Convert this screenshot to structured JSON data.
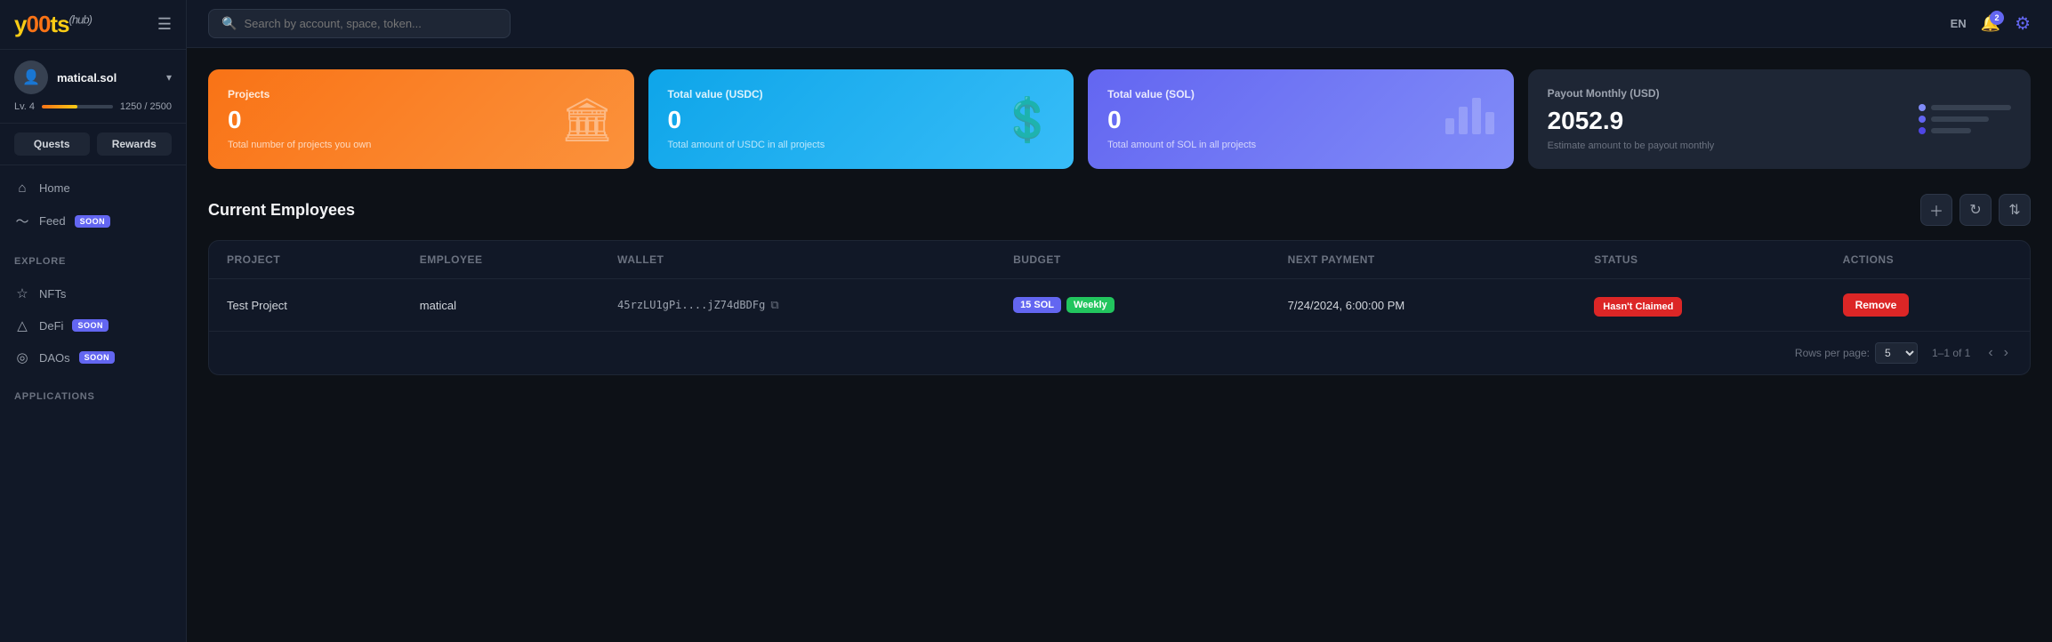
{
  "app": {
    "logo": "y00ts",
    "hub_label": "(hub)"
  },
  "header": {
    "search_placeholder": "Search by account, space, token...",
    "lang_label": "EN",
    "notif_count": "2"
  },
  "sidebar": {
    "user": {
      "username": "matical.sol",
      "level": "Lv. 4",
      "progress_text": "1250 / 2500",
      "progress_pct": 50
    },
    "quests_label": "Quests",
    "rewards_label": "Rewards",
    "nav_items": [
      {
        "id": "home",
        "label": "Home",
        "icon": "⌂",
        "soon": false
      },
      {
        "id": "feed",
        "label": "Feed",
        "icon": "〜",
        "soon": true
      }
    ],
    "explore_label": "Explore",
    "explore_items": [
      {
        "id": "nfts",
        "label": "NFTs",
        "icon": "☆",
        "soon": false
      },
      {
        "id": "defi",
        "label": "DeFi",
        "icon": "△",
        "soon": true
      },
      {
        "id": "daos",
        "label": "DAOs",
        "icon": "◎",
        "soon": true
      }
    ],
    "applications_label": "Applications"
  },
  "stats": {
    "projects": {
      "label": "Projects",
      "value": "0",
      "description": "Total number of projects you own"
    },
    "usdc": {
      "label": "Total value (USDC)",
      "value": "0",
      "description": "Total amount of USDC in all projects"
    },
    "sol": {
      "label": "Total value (SOL)",
      "value": "0",
      "description": "Total amount of SOL in all projects"
    },
    "payout": {
      "label": "Payout Monthly (USD)",
      "value": "2052.9",
      "description": "Estimate amount to be payout monthly"
    }
  },
  "employees": {
    "section_title": "Current Employees",
    "columns": {
      "project": "Project",
      "employee": "Employee",
      "wallet": "Wallet",
      "budget": "Budget",
      "next_payment": "Next Payment",
      "status": "Status",
      "actions": "Actions"
    },
    "rows": [
      {
        "project": "Test Project",
        "employee": "matical",
        "wallet": "45rzLU1gPi....jZ74dBDFg",
        "budget_amount": "15 SOL",
        "budget_frequency": "Weekly",
        "next_payment": "7/24/2024, 6:00:00 PM",
        "status": "Hasn't Claimed",
        "action": "Remove"
      }
    ],
    "footer": {
      "rows_per_page_label": "Rows per page:",
      "rows_per_page_value": "5",
      "page_info": "1–1 of 1"
    }
  }
}
